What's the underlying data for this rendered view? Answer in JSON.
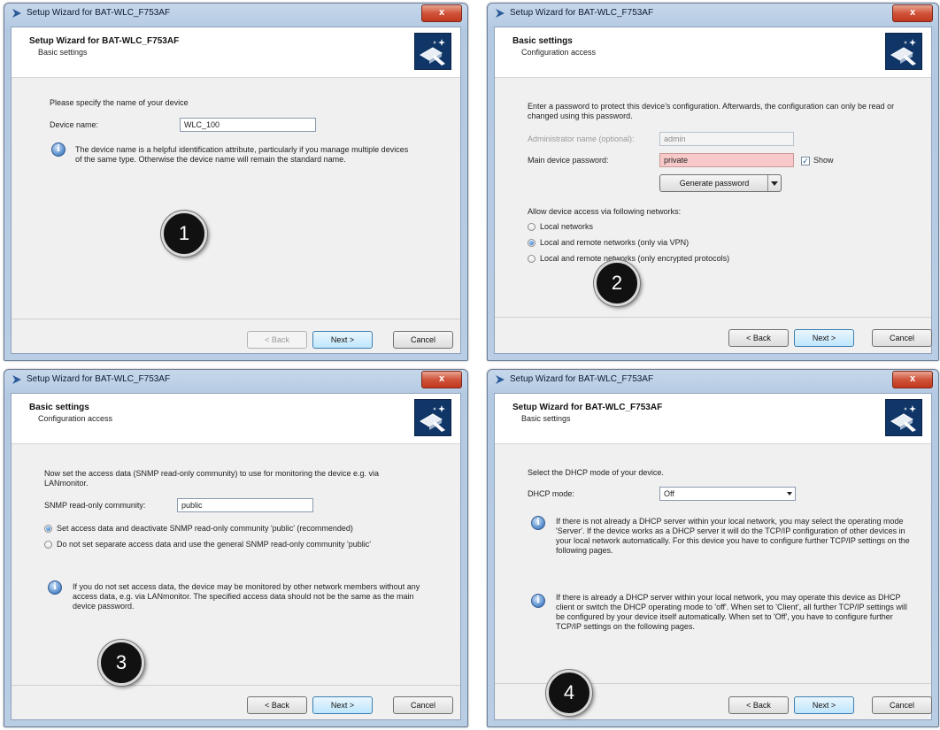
{
  "window_title": "Setup Wizard for BAT-WLC_F753AF",
  "close_label": "x",
  "buttons": {
    "back": "< Back",
    "next": "Next >",
    "cancel": "Cancel"
  },
  "panel1": {
    "header_title": "Setup Wizard for BAT-WLC_F753AF",
    "header_subtitle": "Basic settings",
    "instruction": "Please specify the name of your device",
    "device_name_label": "Device name:",
    "device_name_value": "WLC_100",
    "info": "The device name is a helpful identification attribute, particularly if you manage multiple devices of the same type. Otherwise the device name will remain the standard name.",
    "step": "1"
  },
  "panel2": {
    "header_title": "Basic settings",
    "header_subtitle": "Configuration access",
    "intro": "Enter a password to protect this device’s configuration. Afterwards, the configuration can only be read or changed using this password.",
    "admin_label": "Administrator name (optional):",
    "admin_value": "admin",
    "password_label": "Main device password:",
    "password_value": "private",
    "show_label": "Show",
    "show_checked": true,
    "generate_label": "Generate password",
    "access_label": "Allow device access via following networks:",
    "options": [
      {
        "label": "Local networks",
        "selected": false
      },
      {
        "label": "Local and remote networks (only via VPN)",
        "selected": true
      },
      {
        "label": "Local and remote networks (only encrypted protocols)",
        "selected": false
      }
    ],
    "step": "2"
  },
  "panel3": {
    "header_title": "Basic settings",
    "header_subtitle": "Configuration access",
    "intro": "Now set the access data (SNMP read-only community) to use for monitoring the device e.g. via LANmonitor.",
    "snmp_label": "SNMP read-only community:",
    "snmp_value": "public",
    "options": [
      {
        "label": "Set access data and deactivate SNMP read-only community 'public' (recommended)",
        "selected": true
      },
      {
        "label": "Do not set separate access data and use the general SNMP read-only community 'public'",
        "selected": false
      }
    ],
    "info": "If you do not set access data, the device may be monitored by other network members without any access data, e.g. via LANmonitor. The specified access data should not be the same as the main device password.",
    "step": "3"
  },
  "panel4": {
    "header_title": "Setup Wizard for BAT-WLC_F753AF",
    "header_subtitle": "Basic settings",
    "instruction": "Select the DHCP mode of your device.",
    "dhcp_label": "DHCP mode:",
    "dhcp_value": "Off",
    "info1": "If there is not already a DHCP server within your local network, you may select the operating mode 'Server'. If the device works as a DHCP server it will do the TCP/IP configuration of other devices in your local network automatically. For this device you have to configure further TCP/IP settings on the following pages.",
    "info2": "If there is already a DHCP server within your local network, you may operate this device as DHCP client or switch the DHCP operating mode to 'off'. When set to 'Client', all further TCP/IP settings will be configured by your device itself automatically. When set to 'Off', you have to configure further TCP/IP settings on the following pages.",
    "step": "4"
  }
}
